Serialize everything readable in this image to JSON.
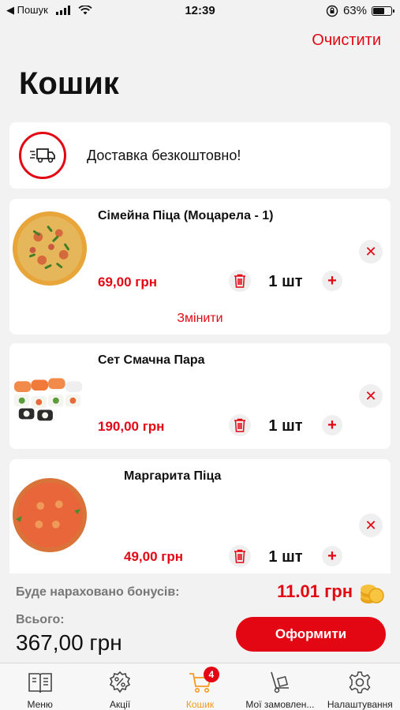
{
  "status_bar": {
    "back_label": "◀ Пошук",
    "time": "12:39",
    "battery": "63%"
  },
  "header": {
    "clear_label": "Очистити",
    "title": "Кошик"
  },
  "delivery": {
    "text": "Доставка безкоштовно!"
  },
  "items": [
    {
      "name": "Сімейна Піца (Моцарела - 1)",
      "price": "69,00 грн",
      "qty": "1 шт"
    },
    {
      "name": "Сет Смачна Пара",
      "price": "190,00 грн",
      "qty": "1 шт"
    },
    {
      "name": "Маргарита Піца",
      "price": "49,00 грн",
      "qty": "1 шт"
    }
  ],
  "change_label": "Змінити",
  "summary": {
    "bonus_label": "Буде нараховано бонусів:",
    "bonus_value": "11.01 грн",
    "total_label": "Всього:",
    "total_value": "367,00 грн",
    "checkout_label": "Оформити"
  },
  "tabs": [
    {
      "label": "Меню",
      "icon": "menu-book-icon"
    },
    {
      "label": "Акції",
      "icon": "discount-badge-icon"
    },
    {
      "label": "Кошик",
      "icon": "cart-icon",
      "badge": "4"
    },
    {
      "label": "Мої замовлен...",
      "icon": "hand-truck-icon"
    },
    {
      "label": "Налаштування",
      "icon": "gear-icon"
    }
  ],
  "colors": {
    "accent": "#e30613",
    "active_tab": "#f39a1f",
    "background": "#f2f2f2"
  }
}
